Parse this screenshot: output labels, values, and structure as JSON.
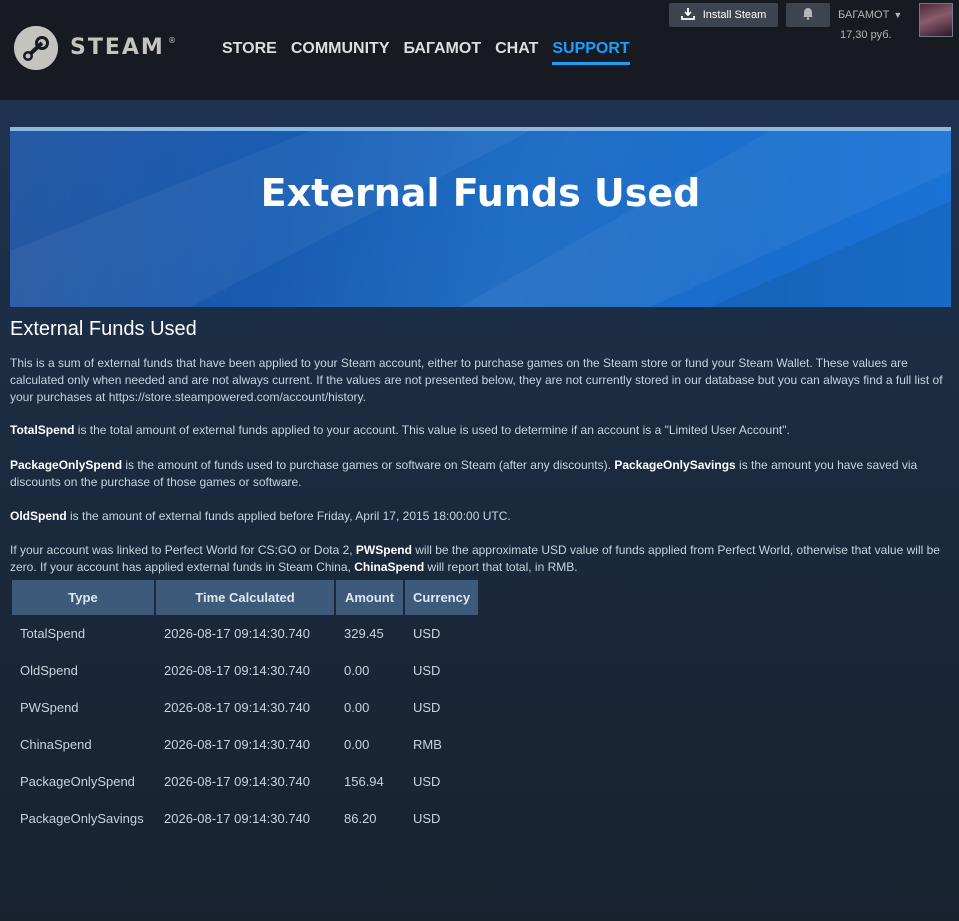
{
  "header": {
    "logo_text": "STEAM",
    "logo_reg": "®",
    "nav": [
      {
        "label": "STORE"
      },
      {
        "label": "COMMUNITY"
      },
      {
        "label": "БАГАМОТ"
      },
      {
        "label": "CHAT"
      },
      {
        "label": "SUPPORT",
        "active": true
      }
    ],
    "install_label": "Install Steam",
    "account_name": "БАГАМОТ",
    "wallet": "17,30 руб."
  },
  "banner": {
    "title": "External Funds Used"
  },
  "section_title": "External Funds Used",
  "paragraphs": {
    "p1": "This is a sum of external funds that have been applied to your Steam account, either to purchase games on the Steam store or fund your Steam Wallet. These values are calculated only when needed and are not always current. If the values are not presented below, they are not currently stored in our database but you can always find a full list of your purchases at https://store.steampowered.com/account/history.",
    "p2_term": "TotalSpend",
    "p2_text": " is the total amount of external funds applied to your account. This value is used to determine if an account is a \"Limited User Account\".",
    "p3_term1": "PackageOnlySpend",
    "p3_text1": " is the amount of funds used to purchase games or software on Steam (after any discounts). ",
    "p3_term2": "PackageOnlySavings",
    "p3_text2": " is the amount you have saved via discounts on the purchase of those games or software.",
    "p4_term": "OldSpend",
    "p4_text": " is the amount of external funds applied before Friday, April 17, 2015 18:00:00 UTC.",
    "p5_text1": "If your account was linked to Perfect World for CS:GO or Dota 2, ",
    "p5_term1": "PWSpend",
    "p5_text2": " will be the approximate USD value of funds applied from Perfect World, otherwise that value will be zero. If your account has applied external funds in Steam China, ",
    "p5_term2": "ChinaSpend",
    "p5_text3": " will report that total, in RMB."
  },
  "table": {
    "headers": [
      "Type",
      "Time Calculated",
      "Amount",
      "Currency"
    ],
    "rows": [
      [
        "TotalSpend",
        "2026-08-17 09:14:30.740",
        "329.45",
        "USD"
      ],
      [
        "OldSpend",
        "2026-08-17 09:14:30.740",
        "0.00",
        "USD"
      ],
      [
        "PWSpend",
        "2026-08-17 09:14:30.740",
        "0.00",
        "USD"
      ],
      [
        "ChinaSpend",
        "2026-08-17 09:14:30.740",
        "0.00",
        "RMB"
      ],
      [
        "PackageOnlySpend",
        "2026-08-17 09:14:30.740",
        "156.94",
        "USD"
      ],
      [
        "PackageOnlySavings",
        "2026-08-17 09:14:30.740",
        "86.20",
        "USD"
      ]
    ]
  },
  "icons": {
    "download": "download-icon",
    "bell": "bell-icon",
    "caret": "caret-down-icon",
    "logo": "steam-logo-icon"
  },
  "colors": {
    "header_bg": "#171a21",
    "page_bg": "#1b2838",
    "accent": "#1a9fff",
    "table_header": "#3d5a7a"
  }
}
